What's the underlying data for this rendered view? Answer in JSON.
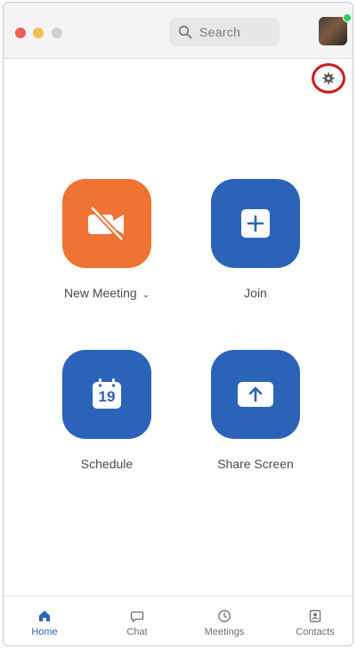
{
  "search": {
    "placeholder": "Search"
  },
  "tiles": {
    "new_meeting": {
      "label": "New Meeting",
      "color": "#ef7332"
    },
    "join": {
      "label": "Join",
      "color": "#2b63b9"
    },
    "schedule": {
      "label": "Schedule",
      "calendar_day": "19",
      "color": "#2b63b9"
    },
    "share_screen": {
      "label": "Share Screen",
      "color": "#2b63b9"
    }
  },
  "tabs": [
    {
      "label": "Home",
      "icon": "home-icon",
      "active": true
    },
    {
      "label": "Chat",
      "icon": "chat-icon",
      "active": false
    },
    {
      "label": "Meetings",
      "icon": "clock-icon",
      "active": false
    },
    {
      "label": "Contacts",
      "icon": "contacts-icon",
      "active": false
    }
  ],
  "colors": {
    "accent": "#2b63b9",
    "orange": "#ef7332",
    "highlight_ring": "#d11a1a",
    "online": "#2fcf52"
  }
}
